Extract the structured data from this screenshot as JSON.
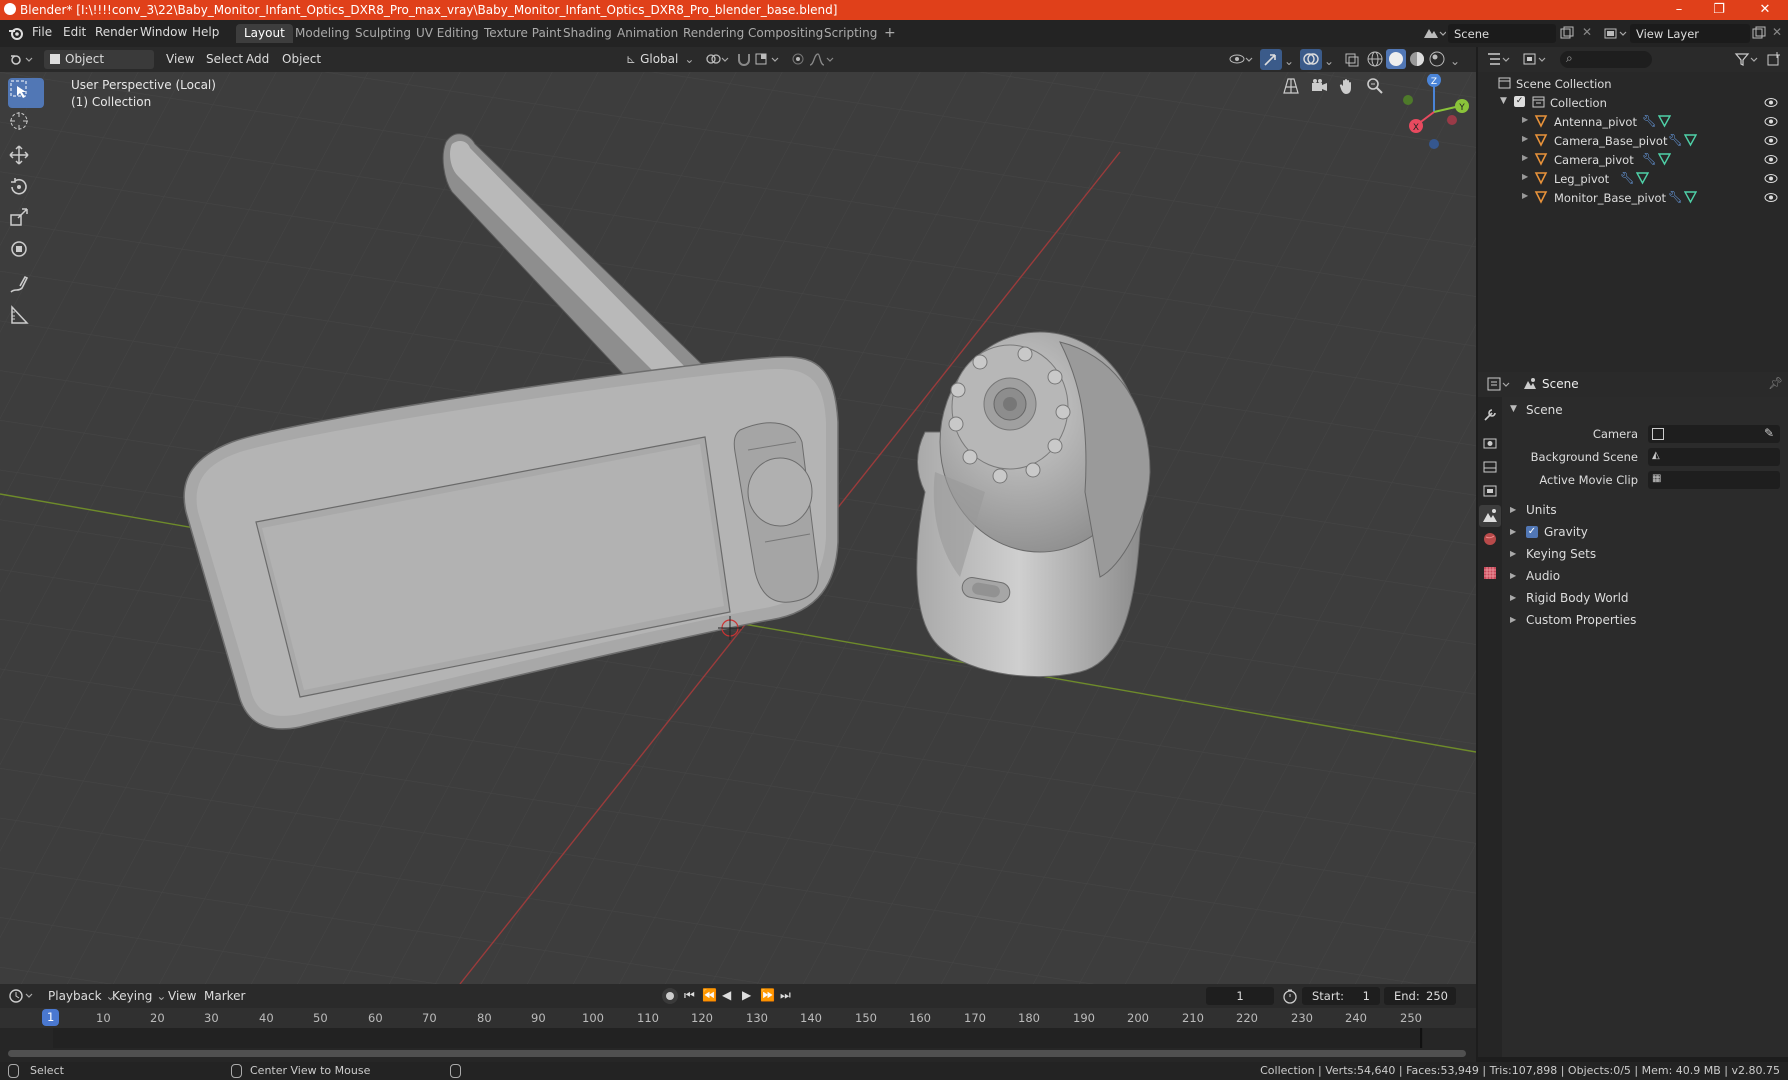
{
  "titlebar": {
    "title": "Blender* [I:\\!!!!conv_3\\22\\Baby_Monitor_Infant_Optics_DXR8_Pro_max_vray\\Baby_Monitor_Infant_Optics_DXR8_Pro_blender_base.blend]",
    "minimize": "–",
    "restore": "❐",
    "close": "✕"
  },
  "menubar": {
    "menus": [
      "File",
      "Edit",
      "Render",
      "Window",
      "Help"
    ],
    "workspaces": [
      "Layout",
      "Modeling",
      "Sculpting",
      "UV Editing",
      "Texture Paint",
      "Shading",
      "Animation",
      "Rendering",
      "Compositing",
      "Scripting"
    ],
    "active_workspace": "Layout",
    "add_tab": "+",
    "scene_value": "Scene",
    "view_layer_value": "View Layer"
  },
  "viewport_header": {
    "mode": "Object Mode",
    "menus": [
      "View",
      "Select",
      "Add",
      "Object"
    ],
    "transform_orientation": "Global"
  },
  "viewport": {
    "perspective_label": "User Perspective (Local)",
    "collection_label": "(1) Collection",
    "axis_colors": {
      "x": "#e84a5f",
      "y": "#8ac33a",
      "z": "#4a84d8"
    }
  },
  "outliner": {
    "root": "Scene Collection",
    "collection": "Collection",
    "objects": [
      "Antenna_pivot",
      "Camera_Base_pivot",
      "Camera_pivot",
      "Leg_pivot",
      "Monitor_Base_pivot"
    ]
  },
  "properties": {
    "context": "Scene",
    "section_scene": "Scene",
    "camera_label": "Camera",
    "background_scene_label": "Background Scene",
    "active_movie_clip_label": "Active Movie Clip",
    "sections": [
      "Units",
      "Gravity",
      "Keying Sets",
      "Audio",
      "Rigid Body World",
      "Custom Properties"
    ],
    "gravity_checked": true
  },
  "timeline": {
    "menus": [
      "Playback",
      "Keying",
      "View",
      "Marker"
    ],
    "current_frame": "1",
    "start_label": "Start:",
    "start_value": "1",
    "end_label": "End:",
    "end_value": "250",
    "ruler_ticks": [
      "1",
      "10",
      "20",
      "30",
      "40",
      "50",
      "60",
      "70",
      "80",
      "90",
      "100",
      "110",
      "120",
      "130",
      "140",
      "150",
      "160",
      "170",
      "180",
      "190",
      "200",
      "210",
      "220",
      "230",
      "240",
      "250"
    ]
  },
  "statusbar": {
    "select": "Select",
    "center_view": "Center View to Mouse",
    "stats": "Collection | Verts:54,640 | Faces:53,949 | Tris:107,898 | Objects:0/5 | Mem: 40.9 MB | v2.80.75"
  }
}
